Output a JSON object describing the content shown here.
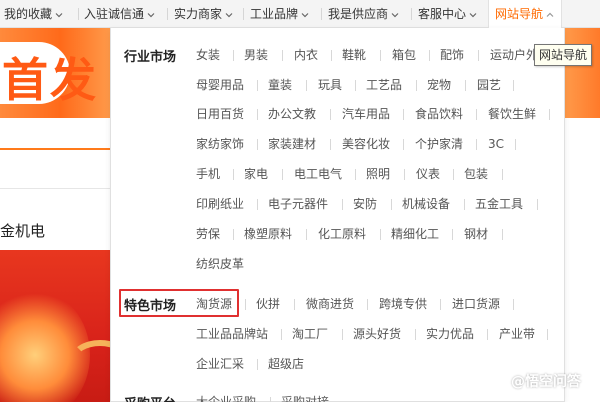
{
  "nav": {
    "items": [
      {
        "label": "我的收藏"
      },
      {
        "label": "入驻诚信通"
      },
      {
        "label": "实力商家"
      },
      {
        "label": "工业品牌"
      },
      {
        "label": "我是供应商"
      },
      {
        "label": "客服中心"
      },
      {
        "label": "网站导航"
      }
    ],
    "active_color": "#ff6a00"
  },
  "background": {
    "banner_text": "首发",
    "label": "金机电"
  },
  "dropdown": {
    "sections": [
      {
        "title": "行业市场",
        "rows": [
          [
            "女装",
            "男装",
            "内衣",
            "鞋靴",
            "箱包",
            "配饰",
            "运动户外"
          ],
          [
            "母婴用品",
            "童装",
            "玩具",
            "工艺品",
            "宠物",
            "园艺"
          ],
          [
            "日用百货",
            "办公文教",
            "汽车用品",
            "食品饮料",
            "餐饮生鲜"
          ],
          [
            "家纺家饰",
            "家装建材",
            "美容化妆",
            "个护家清",
            "3C"
          ],
          [
            "手机",
            "家电",
            "电工电气",
            "照明",
            "仪表",
            "包装"
          ],
          [
            "印刷纸业",
            "电子元器件",
            "安防",
            "机械设备",
            "五金工具"
          ],
          [
            "劳保",
            "橡塑原料",
            "化工原料",
            "精细化工",
            "钢材"
          ],
          [
            "纺织皮革"
          ]
        ]
      },
      {
        "title": "特色市场",
        "rows": [
          [
            "淘货源",
            "伙拼",
            "微商进货",
            "跨境专供",
            "进口货源"
          ],
          [
            "工业品品牌站",
            "淘工厂",
            "源头好货",
            "实力优品",
            "产业带"
          ],
          [
            "企业汇采",
            "超级店"
          ]
        ]
      },
      {
        "title": "采购平台",
        "rows": [
          [
            "大企业采购",
            "采购对接"
          ]
        ]
      }
    ],
    "highlight_color": "#e03030"
  },
  "tooltip": {
    "text": "网站导航"
  },
  "watermark": {
    "text": "@悟空问答"
  },
  "colors": {
    "accent": "#ff6a00",
    "banner": "#ff6a1a"
  }
}
